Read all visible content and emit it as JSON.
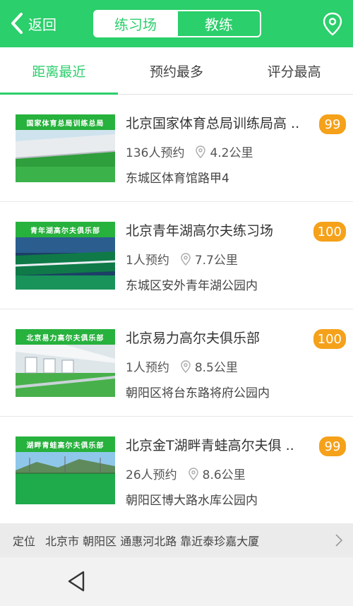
{
  "header": {
    "back_label": "返回",
    "segments": [
      "练习场",
      "教练"
    ],
    "active_segment": 0
  },
  "tabs": [
    "距离最近",
    "预约最多",
    "评分最高"
  ],
  "active_tab": 0,
  "venues": [
    {
      "thumb_caption": "国家体育总局训练总局",
      "title": "北京国家体育总局训练局高 ..",
      "bookings": "136人预约",
      "distance": "4.2公里",
      "address": "东城区体育馆路甲4",
      "score": "99"
    },
    {
      "thumb_caption": "青年湖高尔夫俱乐部",
      "title": "北京青年湖高尔夫练习场",
      "bookings": "1人预约",
      "distance": "7.7公里",
      "address": "东城区安外青年湖公园内",
      "score": "100"
    },
    {
      "thumb_caption": "北京易力高尔夫俱乐部",
      "title": "北京易力高尔夫俱乐部",
      "bookings": "1人预约",
      "distance": "8.5公里",
      "address": "朝阳区将台东路将府公园内",
      "score": "100"
    },
    {
      "thumb_caption": "湖畔青蛙高尔夫俱乐部",
      "title": "北京金T湖畔青蛙高尔夫俱 ..",
      "bookings": "26人预约",
      "distance": "8.6公里",
      "address": "朝阳区博大路水库公园内",
      "score": "99"
    }
  ],
  "location_bar": {
    "label": "定位",
    "text": "北京市 朝阳区 通惠河北路 靠近泰珍嘉大厦"
  },
  "colors": {
    "brand_green": "#2bcf6b",
    "score_orange": "#f5a11a"
  },
  "icons": [
    "chevron-left-icon",
    "location-pin-icon",
    "chevron-right-icon",
    "nav-back-triangle-icon"
  ]
}
